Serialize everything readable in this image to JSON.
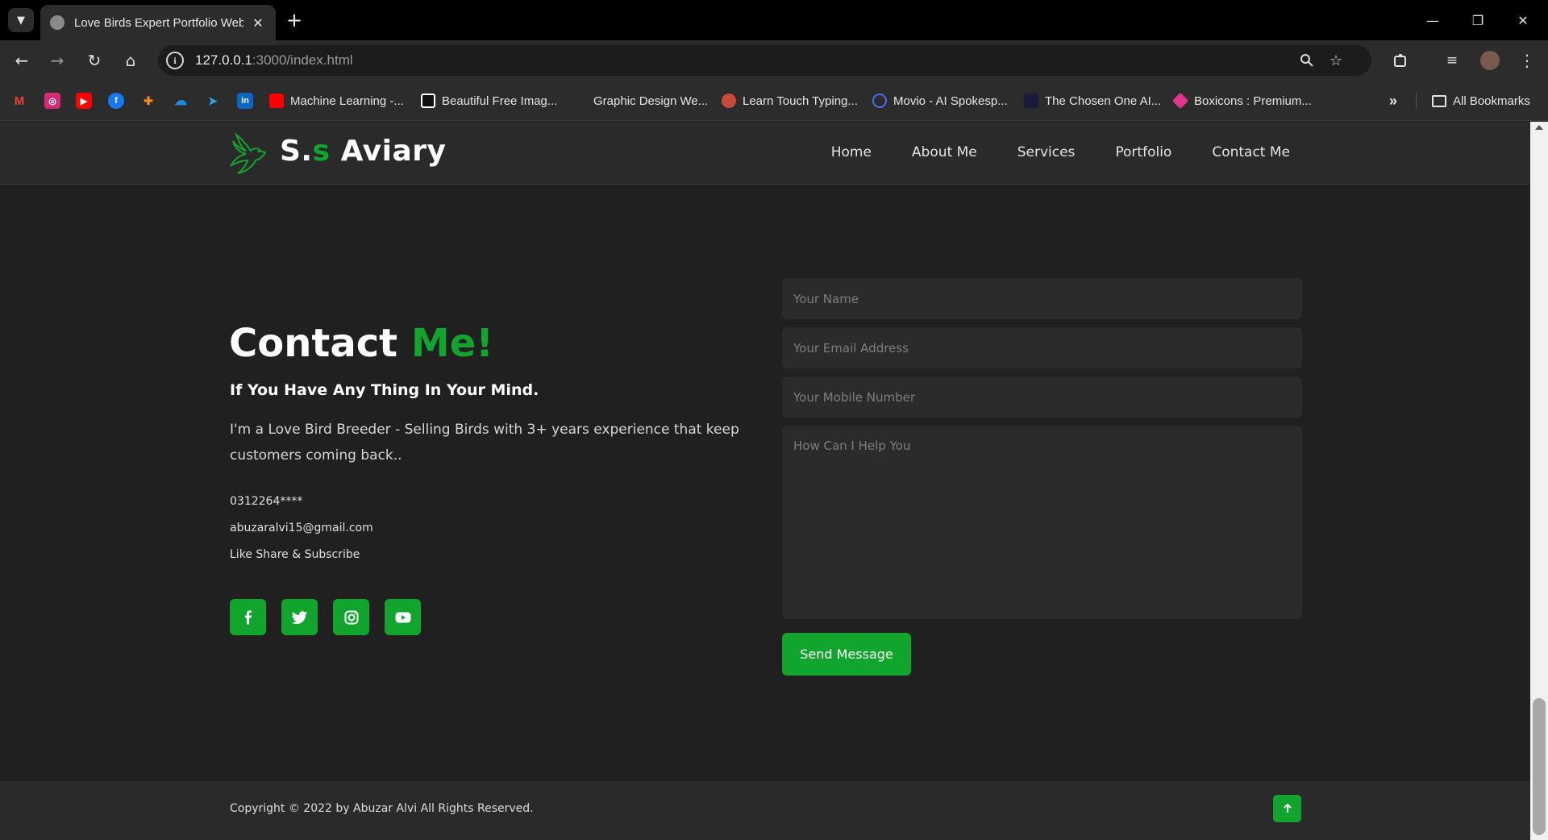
{
  "browser": {
    "tab_title": "Love Birds Expert Portfolio Web",
    "url_host": "127.0.0.1",
    "url_rest": ":3000/index.html",
    "bookmarks": [
      {
        "label": "Machine Learning -...",
        "color": "#ff0000"
      },
      {
        "label": "Beautiful Free Imag...",
        "color": "#111111"
      },
      {
        "label": "Graphic Design We...",
        "color": "#2c2c2c"
      },
      {
        "label": "Learn Touch Typing...",
        "color": "#c94a3a"
      },
      {
        "label": "Movio - AI Spokesp...",
        "color": "#4a6cf7"
      },
      {
        "label": "The Chosen One AI...",
        "color": "#1a1a3a"
      },
      {
        "label": "Boxicons : Premium...",
        "color": "#e0358a"
      }
    ],
    "all_bookmarks_label": "All Bookmarks"
  },
  "site": {
    "logo_prefix": "S.",
    "logo_highlight": "s",
    "logo_suffix": " Aviary",
    "nav": [
      "Home",
      "About Me",
      "Services",
      "Portfolio",
      "Contact Me"
    ],
    "accent_color": "#12a52e"
  },
  "contact": {
    "title_main": "Contact ",
    "title_highlight": "Me!",
    "subtitle": "If You Have Any Thing In Your Mind.",
    "description": "I'm a Love Bird Breeder - Selling Birds with 3+ years experience that keep customers coming back..",
    "phone": "0312264****",
    "email": "abuzaralvi15@gmail.com",
    "tagline": "Like Share & Subscribe",
    "social": [
      "facebook-icon",
      "twitter-icon",
      "instagram-icon",
      "youtube-icon"
    ]
  },
  "form": {
    "name_placeholder": "Your Name",
    "email_placeholder": "Your Email Address",
    "mobile_placeholder": "Your Mobile Number",
    "message_placeholder": "How Can I Help You",
    "submit_label": "Send Message"
  },
  "footer": {
    "copyright": "Copyright © 2022 by Abuzar Alvi All Rights Reserved."
  }
}
